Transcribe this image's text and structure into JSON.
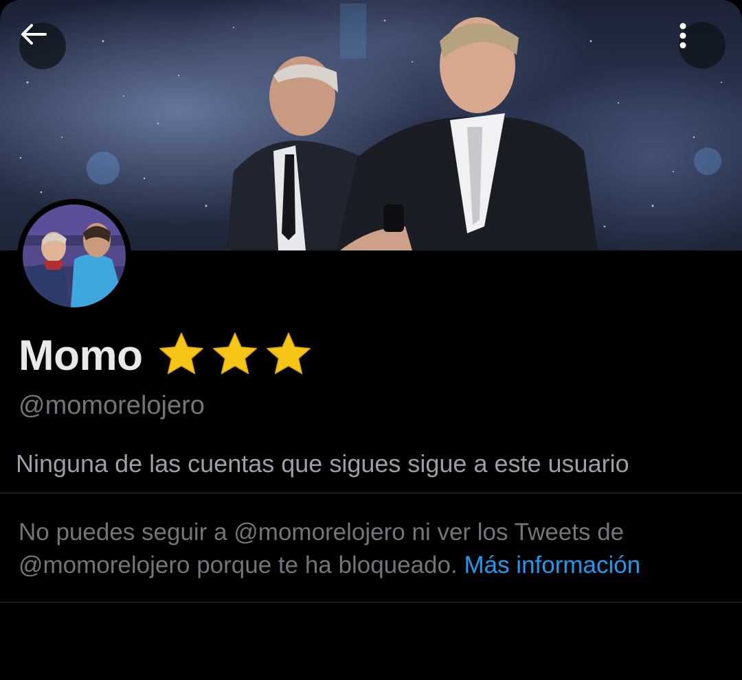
{
  "profile": {
    "display_name": "Momo",
    "name_badges": [
      "star-emoji",
      "star-emoji",
      "star-emoji"
    ],
    "handle": "@momorelojero",
    "followers_you_know": "Ninguna de las cuentas que sigues sigue a este usuario"
  },
  "blocked_notice": {
    "text": "No puedes seguir a @momorelojero ni ver los Tweets de @momorelojero porque te ha bloqueado.",
    "link_label": "Más información"
  },
  "icons": {
    "back": "arrow-left-icon",
    "more": "more-vertical-icon"
  },
  "colors": {
    "background": "#000000",
    "primary_text": "#e7e9ea",
    "secondary_text": "#71767b",
    "link": "#1d9bf0",
    "divider": "#2f3336",
    "star": "#f5c518"
  }
}
